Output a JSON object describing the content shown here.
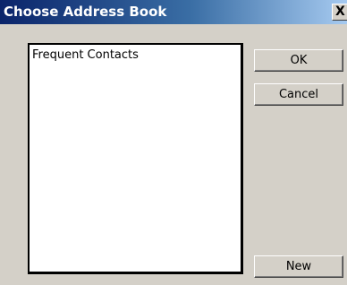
{
  "window": {
    "title": "Choose Address Book",
    "close_glyph": "X"
  },
  "list": {
    "items": [
      {
        "label": "Frequent Contacts"
      }
    ]
  },
  "buttons": {
    "ok": "OK",
    "cancel": "Cancel",
    "new": "New"
  }
}
